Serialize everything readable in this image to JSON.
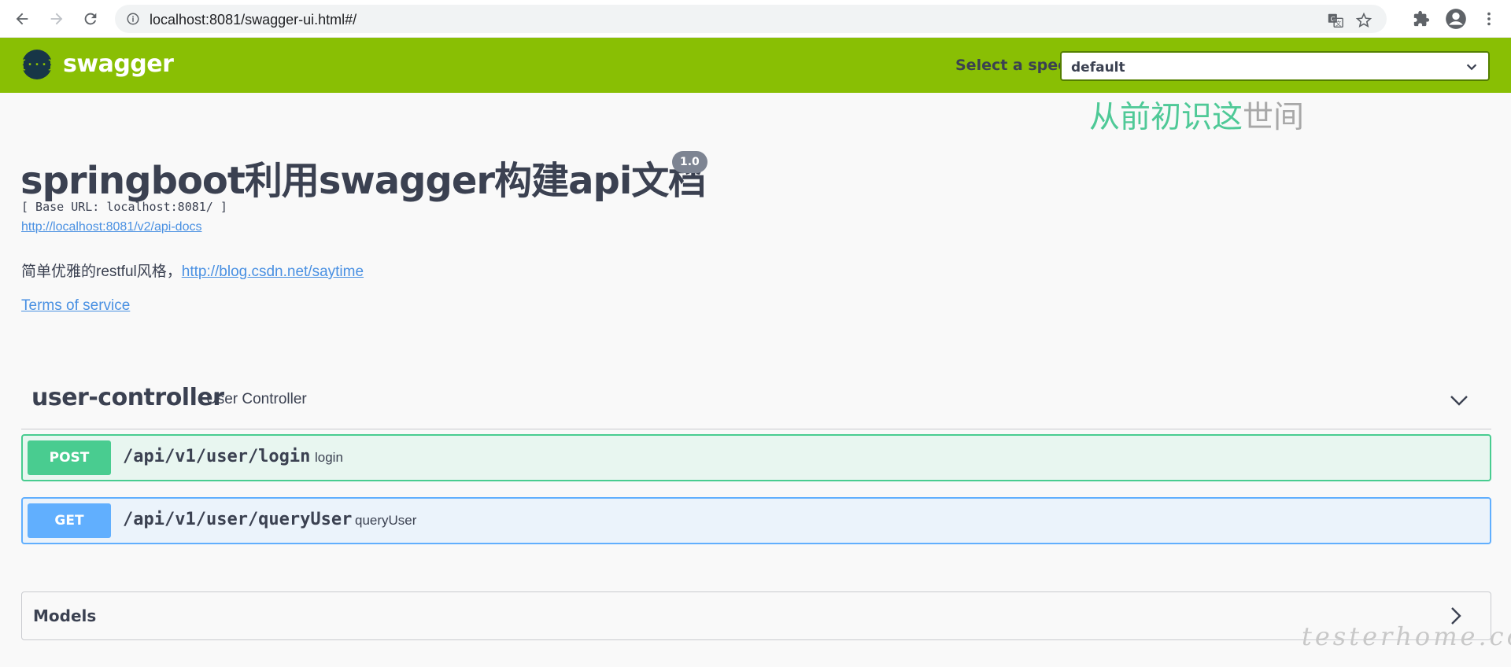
{
  "browser": {
    "url": "localhost:8081/swagger-ui.html#/"
  },
  "topbar": {
    "logo_text": "swagger",
    "logo_glyph": "{···}",
    "spec_label": "Select a spec",
    "spec_value": "default"
  },
  "watermark_top": {
    "green": "从前初识这",
    "gray": "世间"
  },
  "info": {
    "title": "springboot利用swagger构建api文档",
    "version": "1.0",
    "base_url": "[ Base URL: localhost:8081/ ]",
    "api_docs_link": "http://localhost:8081/v2/api-docs",
    "description_text": "简单优雅的restful风格，",
    "description_link": "http://blog.csdn.net/saytime",
    "terms": "Terms of service"
  },
  "tag": {
    "name": "user-controller",
    "description": "User Controller"
  },
  "operations": [
    {
      "method": "POST",
      "path": "/api/v1/user/login",
      "summary": "login"
    },
    {
      "method": "GET",
      "path": "/api/v1/user/queryUser",
      "summary": "queryUser"
    }
  ],
  "models": {
    "title": "Models"
  },
  "watermark_bottom": "testerhome.com",
  "colors": {
    "topbar": "#89bf04",
    "post": "#49cc90",
    "get": "#61affe",
    "link": "#4990e2"
  },
  "icons": {
    "back": "arrow-left-icon",
    "forward": "arrow-right-icon",
    "reload": "reload-icon",
    "info": "info-icon",
    "translate": "translate-icon",
    "bookmark": "star-icon",
    "extensions": "puzzle-icon",
    "profile": "account-icon",
    "menu": "more-vertical-icon",
    "chevron_down": "chevron-down-icon",
    "chevron_right": "chevron-right-icon"
  }
}
